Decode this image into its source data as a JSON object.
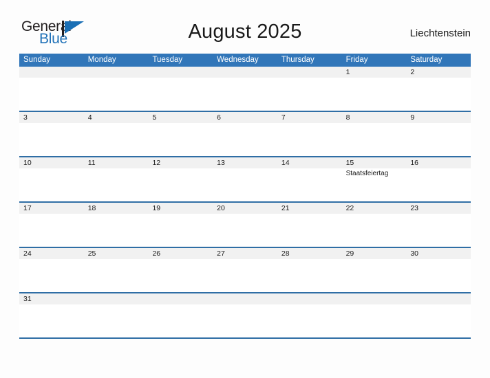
{
  "brand": {
    "name_part1": "General",
    "name_part2": "Blue",
    "mark_icon": "triangle-flag-icon",
    "color_dark": "#231f20",
    "color_blue": "#2172b8"
  },
  "header": {
    "title": "August 2025",
    "country": "Liechtenstein"
  },
  "colors": {
    "header_blue": "#3176b9",
    "rule_blue": "#2f6ea5",
    "band_gray": "#f1f1f1",
    "page_bg": "#fdfdfd",
    "text": "#1a1a1a"
  },
  "calendar": {
    "month": "August",
    "year": "2025",
    "day_headers": [
      "Sunday",
      "Monday",
      "Tuesday",
      "Wednesday",
      "Thursday",
      "Friday",
      "Saturday"
    ],
    "weeks": [
      {
        "days": [
          {
            "num": "",
            "events": []
          },
          {
            "num": "",
            "events": []
          },
          {
            "num": "",
            "events": []
          },
          {
            "num": "",
            "events": []
          },
          {
            "num": "",
            "events": []
          },
          {
            "num": "1",
            "events": []
          },
          {
            "num": "2",
            "events": []
          }
        ]
      },
      {
        "days": [
          {
            "num": "3",
            "events": []
          },
          {
            "num": "4",
            "events": []
          },
          {
            "num": "5",
            "events": []
          },
          {
            "num": "6",
            "events": []
          },
          {
            "num": "7",
            "events": []
          },
          {
            "num": "8",
            "events": []
          },
          {
            "num": "9",
            "events": []
          }
        ]
      },
      {
        "days": [
          {
            "num": "10",
            "events": []
          },
          {
            "num": "11",
            "events": []
          },
          {
            "num": "12",
            "events": []
          },
          {
            "num": "13",
            "events": []
          },
          {
            "num": "14",
            "events": []
          },
          {
            "num": "15",
            "events": [
              "Staatsfeiertag"
            ]
          },
          {
            "num": "16",
            "events": []
          }
        ]
      },
      {
        "days": [
          {
            "num": "17",
            "events": []
          },
          {
            "num": "18",
            "events": []
          },
          {
            "num": "19",
            "events": []
          },
          {
            "num": "20",
            "events": []
          },
          {
            "num": "21",
            "events": []
          },
          {
            "num": "22",
            "events": []
          },
          {
            "num": "23",
            "events": []
          }
        ]
      },
      {
        "days": [
          {
            "num": "24",
            "events": []
          },
          {
            "num": "25",
            "events": []
          },
          {
            "num": "26",
            "events": []
          },
          {
            "num": "27",
            "events": []
          },
          {
            "num": "28",
            "events": []
          },
          {
            "num": "29",
            "events": []
          },
          {
            "num": "30",
            "events": []
          }
        ]
      },
      {
        "days": [
          {
            "num": "31",
            "events": []
          },
          {
            "num": "",
            "events": []
          },
          {
            "num": "",
            "events": []
          },
          {
            "num": "",
            "events": []
          },
          {
            "num": "",
            "events": []
          },
          {
            "num": "",
            "events": []
          },
          {
            "num": "",
            "events": []
          }
        ]
      }
    ]
  }
}
